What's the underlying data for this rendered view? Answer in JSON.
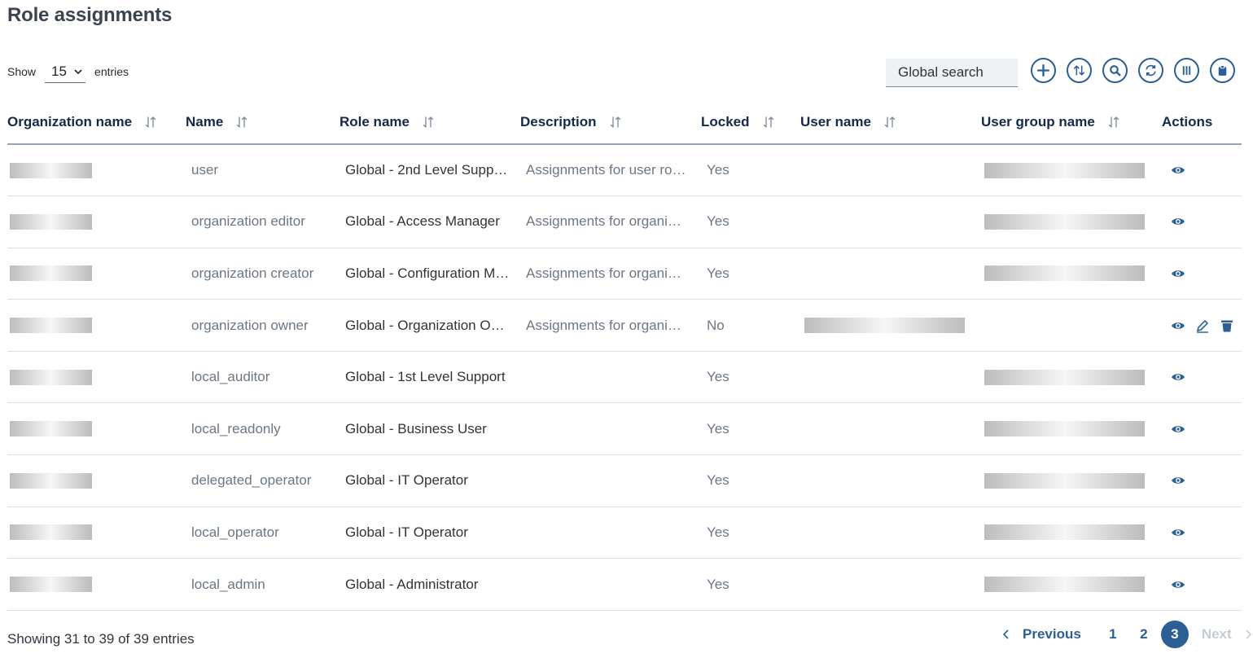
{
  "page": {
    "title": "Role assignments"
  },
  "length": {
    "show": "Show",
    "value": "15",
    "entries": "entries"
  },
  "search": {
    "placeholder": "Global search"
  },
  "toolbar": [
    {
      "name": "add-button",
      "icon": "plus-icon"
    },
    {
      "name": "sort-button",
      "icon": "sort-icon"
    },
    {
      "name": "search-button",
      "icon": "magnifier-icon"
    },
    {
      "name": "refresh-button",
      "icon": "refresh-icon"
    },
    {
      "name": "columns-button",
      "icon": "columns-icon"
    },
    {
      "name": "export-button",
      "icon": "clipboard-icon"
    }
  ],
  "columns": [
    {
      "label": "Organization name",
      "sortable": true
    },
    {
      "label": "Name",
      "sortable": true
    },
    {
      "label": "Role name",
      "sortable": true
    },
    {
      "label": "Description",
      "sortable": true
    },
    {
      "label": "Locked",
      "sortable": true
    },
    {
      "label": "User name",
      "sortable": true
    },
    {
      "label": "User group name",
      "sortable": true
    },
    {
      "label": "Actions",
      "sortable": false
    }
  ],
  "rows": [
    {
      "name": "user",
      "role": "Global - 2nd Level Supp…",
      "description": "Assignments for user ro…",
      "locked": "Yes",
      "user_blur": false,
      "group_blur": true,
      "actions": [
        "view"
      ]
    },
    {
      "name": "organization editor",
      "role": "Global - Access Manager",
      "description": "Assignments for organi…",
      "locked": "Yes",
      "user_blur": false,
      "group_blur": true,
      "actions": [
        "view"
      ]
    },
    {
      "name": "organization creator",
      "role": "Global - Configuration M…",
      "description": "Assignments for organi…",
      "locked": "Yes",
      "user_blur": false,
      "group_blur": true,
      "actions": [
        "view"
      ]
    },
    {
      "name": "organization owner",
      "role": "Global - Organization O…",
      "description": "Assignments for organi…",
      "locked": "No",
      "user_blur": true,
      "group_blur": false,
      "actions": [
        "view",
        "edit",
        "delete"
      ]
    },
    {
      "name": "local_auditor",
      "role": "Global - 1st Level Support",
      "description": "",
      "locked": "Yes",
      "user_blur": false,
      "group_blur": true,
      "actions": [
        "view"
      ]
    },
    {
      "name": "local_readonly",
      "role": "Global - Business User",
      "description": "",
      "locked": "Yes",
      "user_blur": false,
      "group_blur": true,
      "actions": [
        "view"
      ]
    },
    {
      "name": "delegated_operator",
      "role": "Global - IT Operator",
      "description": "",
      "locked": "Yes",
      "user_blur": false,
      "group_blur": true,
      "actions": [
        "view"
      ]
    },
    {
      "name": "local_operator",
      "role": "Global - IT Operator",
      "description": "",
      "locked": "Yes",
      "user_blur": false,
      "group_blur": true,
      "actions": [
        "view"
      ]
    },
    {
      "name": "local_admin",
      "role": "Global - Administrator",
      "description": "",
      "locked": "Yes",
      "user_blur": false,
      "group_blur": true,
      "actions": [
        "view"
      ]
    }
  ],
  "footer": {
    "info": "Showing 31 to 39 of 39 entries"
  },
  "pagination": {
    "previous": "Previous",
    "next": "Next",
    "pages": [
      "1",
      "2",
      "3"
    ],
    "current": "3"
  },
  "colors": {
    "accent": "#2c5f94",
    "header_text": "#15294a",
    "muted_text": "#6b7785"
  }
}
